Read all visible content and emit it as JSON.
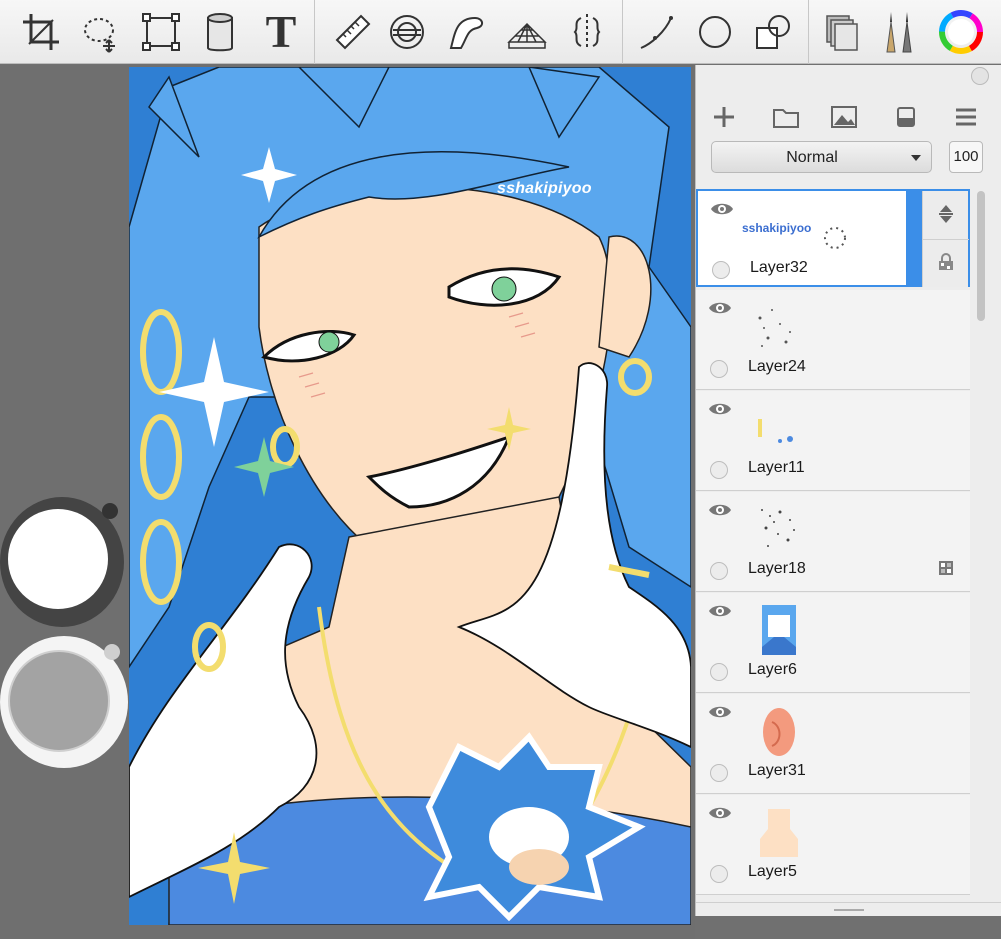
{
  "toolbar": {
    "tools": [
      "crop-icon",
      "lasso-select-icon",
      "transform-icon",
      "fill-bucket-icon",
      "text-icon",
      "ruler-icon",
      "ellipse-ruler-icon",
      "curve-ruler-icon",
      "perspective-icon",
      "symmetry-icon",
      "stroke-icon",
      "circle-icon",
      "shape-icon",
      "layers-icon",
      "brush-icon",
      "color-wheel-icon"
    ],
    "text_tool_glyph": "T"
  },
  "canvas": {
    "watermark": "sshakipiyoo"
  },
  "color_wells": {
    "foreground": "#ffffff",
    "background": "#a3a3a3"
  },
  "layer_panel": {
    "blend_mode": "Normal",
    "opacity": "100",
    "layers": [
      {
        "name": "Layer32",
        "selected": true,
        "locked": false,
        "thumb_text": "sshakipiyoo"
      },
      {
        "name": "Layer24",
        "selected": false,
        "locked": false
      },
      {
        "name": "Layer11",
        "selected": false,
        "locked": false
      },
      {
        "name": "Layer18",
        "selected": false,
        "locked": true
      },
      {
        "name": "Layer6",
        "selected": false,
        "locked": false
      },
      {
        "name": "Layer31",
        "selected": false,
        "locked": false
      },
      {
        "name": "Layer5",
        "selected": false,
        "locked": false
      }
    ]
  },
  "colors": {
    "accent": "#3b8ee8",
    "hair": "#4f9fe8",
    "skin": "#fde0c4",
    "background": "#2f7fd3",
    "gold": "#f3dd6e",
    "eyes": "#7fd19a"
  }
}
